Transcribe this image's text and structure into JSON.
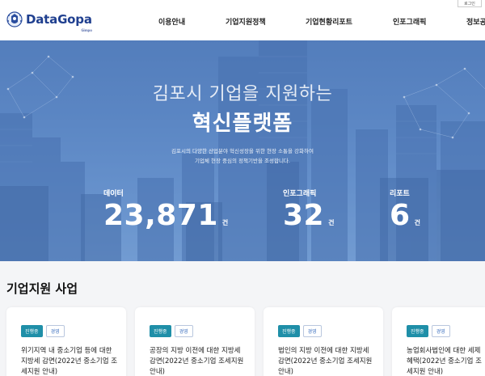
{
  "header": {
    "logo_text": "DataGopa",
    "logo_sub": "Gimpo",
    "login_label": "로그인",
    "nav": [
      "이용안내",
      "기업지원정책",
      "기업현황리포트",
      "인포그래픽",
      "정보공개"
    ]
  },
  "hero": {
    "title_line1": "김포시 기업을 지원하는",
    "title_line2": "혁신플랫폼",
    "desc_line1": "김포시의 다양한 산업분야 혁신성장을 위한 현장 소통을 강화하여",
    "desc_line2": "기업체 현장 중심의 정책기반을 조성합니다.",
    "stats": [
      {
        "label": "데이터",
        "value": "23,871",
        "unit": "건"
      },
      {
        "label": "인포그래픽",
        "value": "32",
        "unit": "건"
      },
      {
        "label": "리포트",
        "value": "6",
        "unit": "건"
      }
    ]
  },
  "section": {
    "title": "기업지원 사업",
    "cards": [
      {
        "status": "진행중",
        "type": "경영",
        "title": "위기지역 내 중소기업 등에 대한 지방세 감면(2022년 중소기업 조세지원 안내)"
      },
      {
        "status": "진행중",
        "type": "경영",
        "title": "공장의 지방 이전에 대한 지방세 감면(2022년 중소기업 조세지원 안내)"
      },
      {
        "status": "진행중",
        "type": "경영",
        "title": "법인의 지방 이전에 대한 지방세 감면(2022년 중소기업 조세지원 안내)"
      },
      {
        "status": "진행중",
        "type": "경영",
        "title": "농업회사법인에 대한 세제혜택(2022년 중소기업 조세지원 안내)"
      }
    ]
  }
}
